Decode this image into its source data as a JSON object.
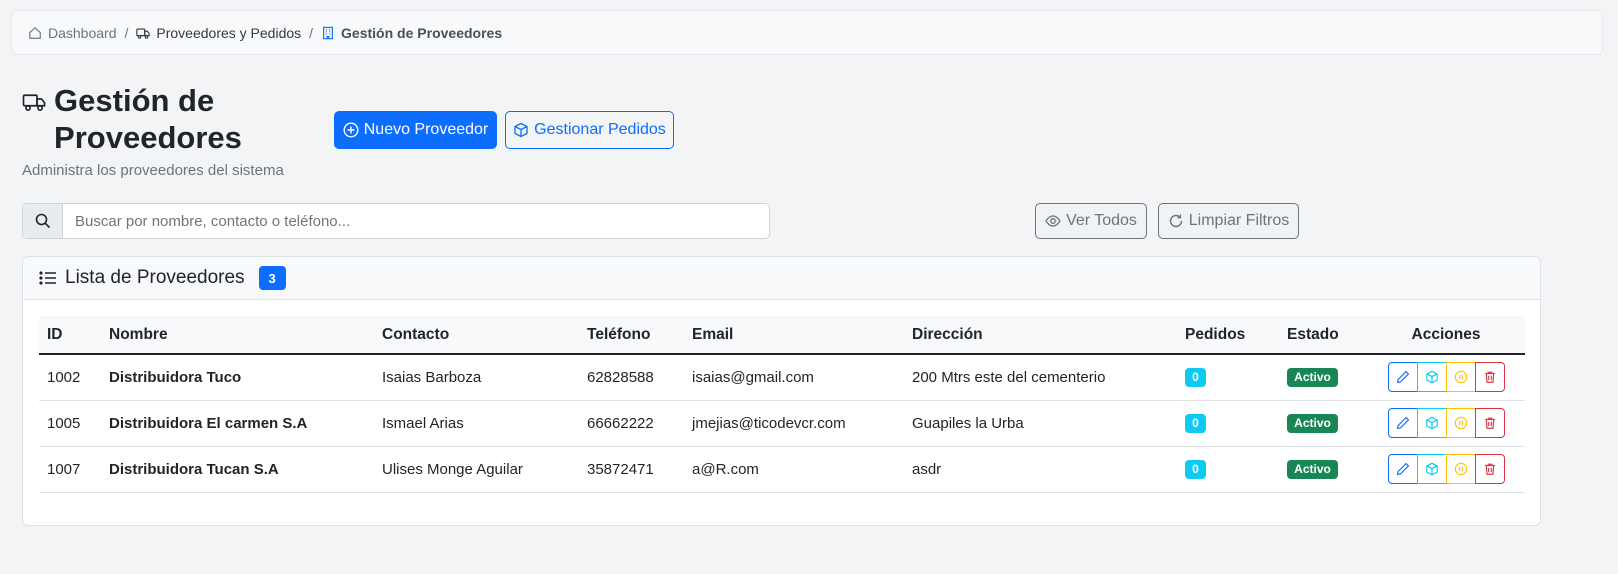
{
  "breadcrumb": {
    "dashboard": "Dashboard",
    "proveedores_pedidos": "Proveedores y Pedidos",
    "current": "Gestión de Proveedores",
    "separator": "/"
  },
  "header": {
    "title": "Gestión de Proveedores",
    "subtitle": "Administra los proveedores del sistema",
    "nuevo_label": "Nuevo Proveedor",
    "gestionar_label": "Gestionar Pedidos"
  },
  "search": {
    "placeholder": "Buscar por nombre, contacto o teléfono...",
    "value": ""
  },
  "filters": {
    "ver_todos_label": "Ver Todos",
    "limpiar_label": "Limpiar Filtros"
  },
  "list": {
    "title": "Lista de Proveedores",
    "count": "3",
    "columns": {
      "id": "ID",
      "nombre": "Nombre",
      "contacto": "Contacto",
      "telefono": "Teléfono",
      "email": "Email",
      "direccion": "Dirección",
      "pedidos": "Pedidos",
      "estado": "Estado",
      "acciones": "Acciones"
    },
    "rows": [
      {
        "id": "1002",
        "nombre": "Distribuidora Tuco",
        "contacto": "Isaias Barboza",
        "telefono": "62828588",
        "email": "isaias@gmail.com",
        "direccion": "200 Mtrs este del cementerio",
        "pedidos": "0",
        "estado": "Activo"
      },
      {
        "id": "1005",
        "nombre": "Distribuidora El carmen S.A",
        "contacto": "Ismael Arias",
        "telefono": "66662222",
        "email": "jmejias@ticodevcr.com",
        "direccion": "Guapiles la Urba",
        "pedidos": "0",
        "estado": "Activo"
      },
      {
        "id": "1007",
        "nombre": "Distribuidora Tucan S.A",
        "contacto": "Ulises Monge Aguilar",
        "telefono": "35872471",
        "email": "a@R.com",
        "direccion": "asdr",
        "pedidos": "0",
        "estado": "Activo"
      }
    ]
  },
  "colors": {
    "primary": "#0d6efd",
    "info": "#0dcaf0",
    "warning": "#ffc107",
    "danger": "#dc3545",
    "success": "#198754",
    "secondary": "#6c757d"
  },
  "icons": {
    "breadcrumb": [
      "house-icon",
      "truck-icon",
      "building-icon"
    ],
    "title": "truck-icon",
    "nuevo": "plus-circle-icon",
    "gestionar": "box-icon",
    "search": "search-icon",
    "ver_todos": "eye-icon",
    "limpiar": "refresh-icon",
    "list": "list-icon",
    "actions": [
      "pencil-icon",
      "box-icon",
      "pause-circle-icon",
      "trash-icon"
    ]
  }
}
